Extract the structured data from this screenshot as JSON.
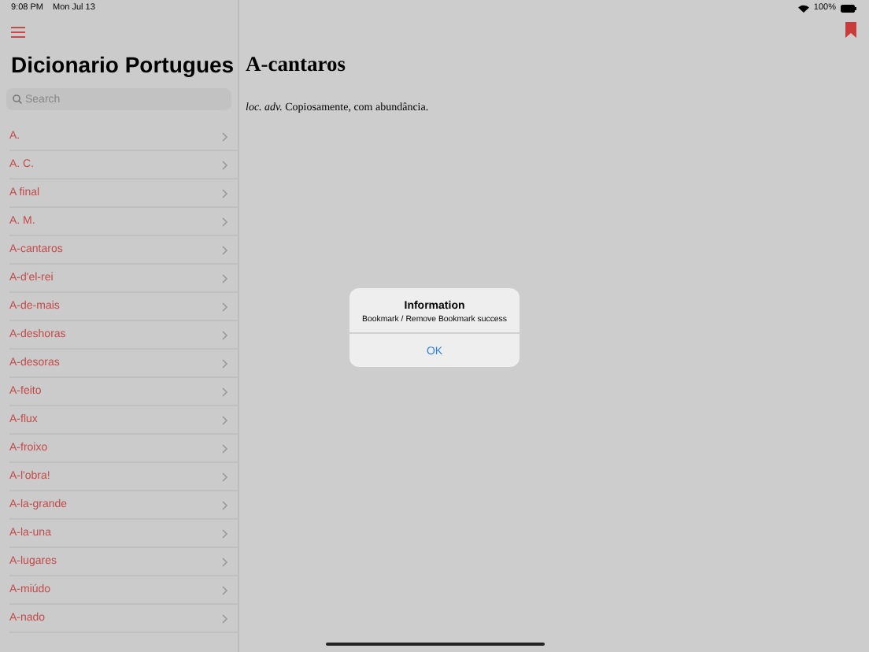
{
  "status_bar": {
    "time": "9:08 PM",
    "date": "Mon Jul 13",
    "battery": "100%"
  },
  "sidebar": {
    "title": "Dicionario Portugues",
    "search": {
      "placeholder": "Search"
    },
    "items": [
      {
        "label": "A."
      },
      {
        "label": "A. C."
      },
      {
        "label": "A final"
      },
      {
        "label": "A. M."
      },
      {
        "label": "A-cantaros"
      },
      {
        "label": "A-d'el-rei"
      },
      {
        "label": "A-de-mais"
      },
      {
        "label": "A-deshoras"
      },
      {
        "label": "A-desoras"
      },
      {
        "label": "A-feito"
      },
      {
        "label": "A-flux"
      },
      {
        "label": "A-froixo"
      },
      {
        "label": "A-l'obra!"
      },
      {
        "label": "A-la-grande"
      },
      {
        "label": "A-la-una"
      },
      {
        "label": "A-lugares"
      },
      {
        "label": "A-miúdo"
      },
      {
        "label": "A-nado"
      }
    ]
  },
  "detail": {
    "title": "A-cantaros",
    "definition": "*loc. adv.* Copiosamente, com abundância.",
    "bookmarked": true
  },
  "alert": {
    "title": "Information",
    "message": "Bookmark / Remove Bookmark success",
    "buttons": [
      "OK"
    ]
  }
}
